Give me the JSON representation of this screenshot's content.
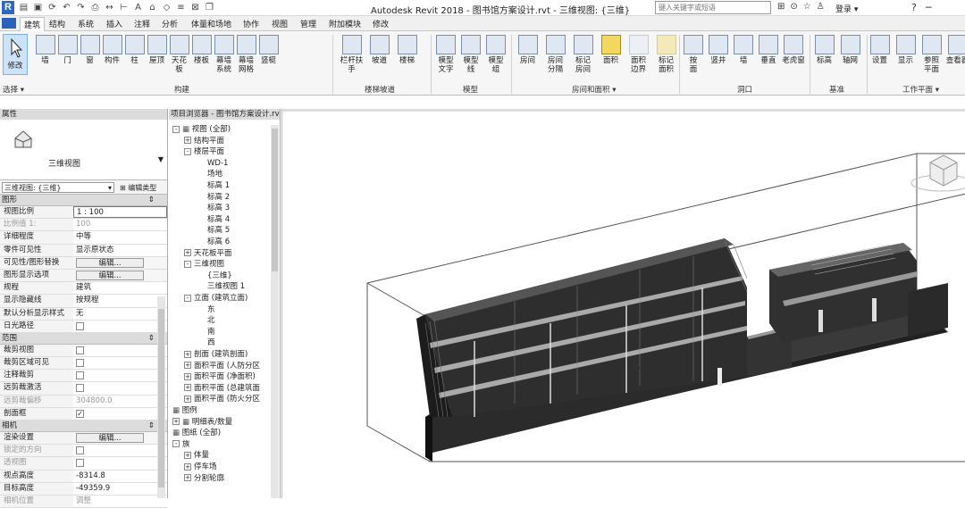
{
  "titlebar": {
    "logo": "R",
    "title": "Autodesk Revit 2018 -    图书馆方案设计.rvt - 三维视图: {三维}",
    "search_placeholder": "键入关键字或短语",
    "login": "登录",
    "quick_access": [
      "open-icon",
      "save-icon",
      "sync-icon",
      "undo-icon",
      "redo-icon",
      "print-icon",
      "measure-icon",
      "dimension-icon",
      "text-icon",
      "3d-icon",
      "section-icon",
      "thin-lines-icon",
      "close-hidden-icon",
      "switch-window-icon"
    ]
  },
  "tabs": [
    "建筑",
    "结构",
    "系统",
    "插入",
    "注释",
    "分析",
    "体量和场地",
    "协作",
    "视图",
    "管理",
    "附加模块",
    "修改"
  ],
  "active_tab": "建筑",
  "ribbon": {
    "modify": "修改",
    "select": "选择",
    "groups": [
      {
        "label": "构建",
        "buttons": [
          "墙",
          "门",
          "窗",
          "构件",
          "柱",
          "屋顶",
          "天花板",
          "楼板",
          "幕墙\n系统",
          "幕墙\n网格",
          "竖梃"
        ]
      },
      {
        "label": "楼梯坡道",
        "buttons": [
          "栏杆扶手",
          "坡道",
          "楼梯"
        ]
      },
      {
        "label": "模型",
        "buttons": [
          "模型\n文字",
          "模型\n线",
          "模型\n组"
        ]
      },
      {
        "label": "房间和面积",
        "buttons": [
          "房间",
          "房间\n分隔",
          "标记\n房间",
          "面积",
          "面积\n边界",
          "标记\n面积"
        ]
      },
      {
        "label": "洞口",
        "buttons": [
          "按\n面",
          "竖井",
          "墙",
          "垂直",
          "老虎窗"
        ]
      },
      {
        "label": "基准",
        "buttons": [
          "标高",
          "轴网"
        ]
      },
      {
        "label": "工作平面",
        "buttons": [
          "设置",
          "显示",
          "参照\n平面",
          "查看器"
        ]
      }
    ]
  },
  "properties": {
    "title": "属性",
    "type_name": "三维视图",
    "view_selector": "三维视图: {三维}",
    "edit_type": "编辑类型",
    "categories": [
      {
        "name": "图形",
        "rows": [
          {
            "k": "视图比例",
            "v": "1 : 100",
            "kind": "input"
          },
          {
            "k": "比例值 1:",
            "v": "100",
            "kind": "grey"
          },
          {
            "k": "详细程度",
            "v": "中等"
          },
          {
            "k": "零件可见性",
            "v": "显示原状态"
          },
          {
            "k": "可见性/图形替换",
            "v": "编辑...",
            "kind": "btn"
          },
          {
            "k": "图形显示选项",
            "v": "编辑...",
            "kind": "btn"
          },
          {
            "k": "规程",
            "v": "建筑"
          },
          {
            "k": "显示隐藏线",
            "v": "按规程"
          },
          {
            "k": "默认分析显示样式",
            "v": "无"
          },
          {
            "k": "日光路径",
            "v": "",
            "kind": "chk"
          }
        ]
      },
      {
        "name": "范围",
        "rows": [
          {
            "k": "裁剪视图",
            "v": "",
            "kind": "chk"
          },
          {
            "k": "裁剪区域可见",
            "v": "",
            "kind": "chk"
          },
          {
            "k": "注释裁剪",
            "v": "",
            "kind": "chk"
          },
          {
            "k": "远剪裁激活",
            "v": "",
            "kind": "chk"
          },
          {
            "k": "远剪裁偏移",
            "v": "304800.0",
            "kind": "grey"
          },
          {
            "k": "剖面框",
            "v": "✓",
            "kind": "chk"
          }
        ]
      },
      {
        "name": "相机",
        "rows": [
          {
            "k": "渲染设置",
            "v": "编辑...",
            "kind": "btn"
          },
          {
            "k": "锁定的方向",
            "v": "",
            "kind": "chkgrey"
          },
          {
            "k": "透视图",
            "v": "",
            "kind": "chkgrey"
          },
          {
            "k": "视点高度",
            "v": "-8314.8"
          },
          {
            "k": "目标高度",
            "v": "-49359.9"
          },
          {
            "k": "相机位置",
            "v": "调整",
            "kind": "grey"
          }
        ]
      }
    ]
  },
  "browser": {
    "title": "项目浏览器 - 图书馆方案设计.rvt",
    "nodes": [
      {
        "t": "视图 (全部)",
        "lvl": 0,
        "exp": "-",
        "icon": true
      },
      {
        "t": "结构平面",
        "lvl": 1,
        "exp": "+"
      },
      {
        "t": "楼层平面",
        "lvl": 1,
        "exp": "-"
      },
      {
        "t": "WD-1",
        "lvl": 3
      },
      {
        "t": "场地",
        "lvl": 3
      },
      {
        "t": "标高 1",
        "lvl": 3
      },
      {
        "t": "标高 2",
        "lvl": 3
      },
      {
        "t": "标高 3",
        "lvl": 3
      },
      {
        "t": "标高 4",
        "lvl": 3
      },
      {
        "t": "标高 5",
        "lvl": 3
      },
      {
        "t": "标高 6",
        "lvl": 3
      },
      {
        "t": "天花板平面",
        "lvl": 1,
        "exp": "+"
      },
      {
        "t": "三维视图",
        "lvl": 1,
        "exp": "-"
      },
      {
        "t": "{三维}",
        "lvl": 3
      },
      {
        "t": "三维视图 1",
        "lvl": 3
      },
      {
        "t": "立面 (建筑立面)",
        "lvl": 1,
        "exp": "-"
      },
      {
        "t": "东",
        "lvl": 3
      },
      {
        "t": "北",
        "lvl": 3
      },
      {
        "t": "南",
        "lvl": 3
      },
      {
        "t": "西",
        "lvl": 3
      },
      {
        "t": "剖面 (建筑剖面)",
        "lvl": 1,
        "exp": "+"
      },
      {
        "t": "面积平面 (人防分区",
        "lvl": 1,
        "exp": "+"
      },
      {
        "t": "面积平面 (净面积)",
        "lvl": 1,
        "exp": "+"
      },
      {
        "t": "面积平面 (总建筑面",
        "lvl": 1,
        "exp": "+"
      },
      {
        "t": "面积平面 (防火分区",
        "lvl": 1,
        "exp": "+"
      },
      {
        "t": "图例",
        "lvl": 0,
        "icon": true
      },
      {
        "t": "明细表/数量",
        "lvl": 0,
        "exp": "+",
        "icon": true
      },
      {
        "t": "图纸 (全部)",
        "lvl": 0,
        "icon": true
      },
      {
        "t": "族",
        "lvl": 0,
        "exp": "-"
      },
      {
        "t": "体量",
        "lvl": 1,
        "exp": "+"
      },
      {
        "t": "停车场",
        "lvl": 1,
        "exp": "+"
      },
      {
        "t": "分割轮廓",
        "lvl": 1,
        "exp": "+"
      }
    ]
  },
  "colors": {
    "accent": "#2c67c4",
    "select_bg": "#cde3f7",
    "panel": "#f4f4f4"
  }
}
